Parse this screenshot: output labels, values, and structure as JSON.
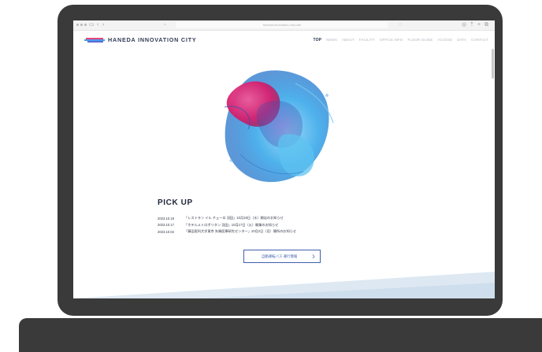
{
  "browser": {
    "url": "haneda-innovation-city.com"
  },
  "header": {
    "brand": "HANEDA INNOVATION CITY",
    "logo_colors": [
      "#e5467a",
      "#4a9be8",
      "#5c6bd6"
    ]
  },
  "nav": [
    {
      "label": "TOP",
      "active": true
    },
    {
      "label": "NEWS"
    },
    {
      "label": "ABOUT"
    },
    {
      "label": "FACILITY"
    },
    {
      "label": "OFFICE INFO"
    },
    {
      "label": "FLOOR GUIDE"
    },
    {
      "label": "ACCESS"
    },
    {
      "label": "DATA"
    },
    {
      "label": "CONTACT"
    }
  ],
  "pickup": {
    "heading": "PICK UP",
    "items": [
      {
        "date": "2023.10.18",
        "text": "「レストラン イル チェーロ 羽田」10月18日（水）開店のお知らせ"
      },
      {
        "date": "2023.10.17",
        "text": "「ホテルメトロポリタン 羽田」10月17日（火）開業のお知らせ"
      },
      {
        "date": "2023.10.02",
        "text": "「藤田医科大学東京 先端医療研究センター」10月2日（月）開所のお知らせ"
      }
    ]
  },
  "more_button": {
    "label": "自動運転バス 運行情報",
    "icon": "chevron-right-icon"
  },
  "colors": {
    "bezel": "#3a3a3a",
    "brand_text": "#2f3a56",
    "button_accent": "#3e5fae",
    "art_pink": "#e0287a",
    "art_blue": "#3aa9ea"
  }
}
